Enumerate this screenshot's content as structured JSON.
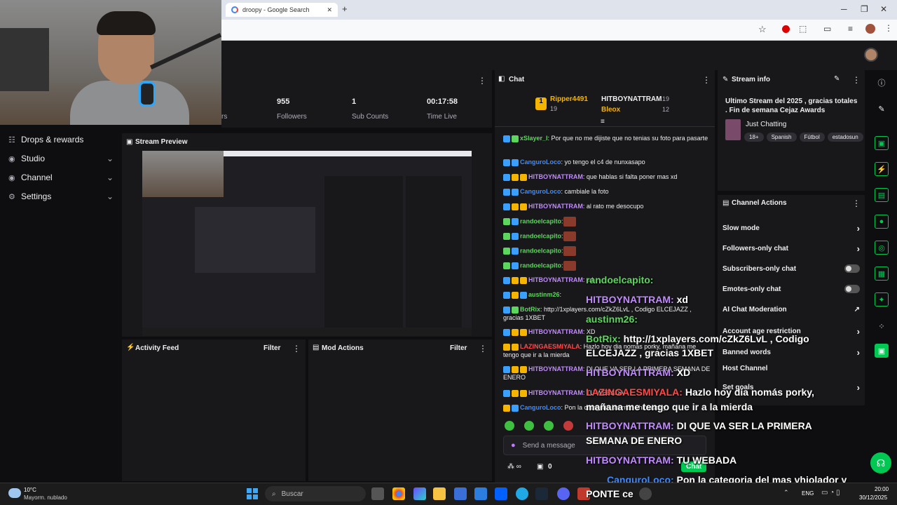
{
  "browser": {
    "tab_title": "droopy - Google Search",
    "new_tab": "+",
    "close_tab": "✕",
    "minimize": "─",
    "restore": "❐",
    "close": "✕"
  },
  "nav": {
    "items": [
      {
        "label": "Drops & rewards",
        "icon": "gift-icon"
      },
      {
        "label": "Studio",
        "icon": "studio-icon"
      },
      {
        "label": "Channel",
        "icon": "channel-icon"
      },
      {
        "label": "Settings",
        "icon": "gear-icon"
      }
    ]
  },
  "stats": {
    "viewers_label": "rs",
    "followers_value": "955",
    "followers_label": "Followers",
    "subs_value": "1",
    "subs_label": "Sub Counts",
    "time_value": "00:17:58",
    "time_label": "Time Live"
  },
  "preview": {
    "title": "Stream Preview"
  },
  "activity": {
    "title": "Activity Feed",
    "filter": "Filter"
  },
  "modactions": {
    "title": "Mod Actions",
    "filter": "Filter"
  },
  "chat": {
    "title": "Chat",
    "leaders": [
      {
        "rank": "1",
        "name": "Ripper4491",
        "count": "19"
      },
      {
        "name": "HITBOYNATTRAM",
        "count": "19"
      },
      {
        "name": "Bleox",
        "count": "12"
      }
    ],
    "messages": [
      {
        "user": "xSlayer_l",
        "color": "green",
        "text": ": Por que no me dijiste que no tenias su foto para pasarte"
      },
      {
        "user": "CanguroLoco",
        "color": "blue",
        "text": ": yo tengo el c4 de nunxasapo"
      },
      {
        "user": "HITBOYNATTRAM",
        "color": "purple",
        "text": ": que hablas si falta poner mas xd"
      },
      {
        "user": "CanguroLoco",
        "color": "blue",
        "text": ": cambiale la foto"
      },
      {
        "user": "HITBOYNATTRAM",
        "color": "purple",
        "text": ": al rato me desocupo"
      },
      {
        "user": "randoelcapito",
        "color": "green",
        "text": ":"
      },
      {
        "user": "randoelcapito",
        "color": "green",
        "text": ":"
      },
      {
        "user": "randoelcapito",
        "color": "green",
        "text": ":"
      },
      {
        "user": "randoelcapito",
        "color": "green",
        "text": ":"
      },
      {
        "user": "HITBOYNATTRAM",
        "color": "purple",
        "text": ": xd"
      },
      {
        "user": "austinm26",
        "color": "green",
        "text": ":"
      },
      {
        "user": "BotRix",
        "color": "green",
        "text": ": http://1xplayers.com/cZkZ6LvL , Codigo ELCEJAZZ , gracias 1XBET"
      },
      {
        "user": "HITBOYNATTRAM",
        "color": "purple",
        "text": ": XD"
      },
      {
        "user": "LAZINGAESMIYALA",
        "color": "red",
        "text": ": Hazlo hoy dia nomás porky, mañana me tengo que ir a la mierda"
      },
      {
        "user": "HITBOYNATTRAM",
        "color": "purple",
        "text": ": DI QUE VA SER LA PRIMERA SEMANA DE ENERO"
      },
      {
        "user": "HITBOYNATTRAM",
        "color": "purple",
        "text": ": TU WEBADA"
      },
      {
        "user": "CanguroLoco",
        "color": "blue",
        "text": ": Pon la categoria del mas vhiolador y"
      }
    ],
    "input_placeholder": "Send a message",
    "points": "0",
    "chat_button": "Chat"
  },
  "overlay": {
    "lines": [
      {
        "user": "randoelcapito:",
        "text": ""
      },
      {
        "user": "HITBOYNATTRAM:",
        "text": " xd"
      },
      {
        "user": "austinm26:",
        "text": ""
      },
      {
        "user": "BotRix:",
        "text": " http://1xplayers.com/cZkZ6LvL , Codigo"
      },
      {
        "user": "",
        "text": "ELCEJAZZ , gracias 1XBET"
      },
      {
        "user": "HITBOYNATTRAM:",
        "text": " XD"
      },
      {
        "user": "LAZINGAESMIYALA:",
        "text": " Hazlo hoy día nomás porky,"
      },
      {
        "user": "",
        "text": "mañana me tengo que ir a la mierda"
      },
      {
        "user": "HITBOYNATTRAM:",
        "text": " DI QUE VA SER LA PRIMERA"
      },
      {
        "user": "",
        "text": "SEMANA DE ENERO"
      },
      {
        "user": "HITBOYNATTRAM:",
        "text": " TU WEBADA"
      },
      {
        "user": "CanguroLoco:",
        "text": " Pon la categoria del mas vhiolador y"
      }
    ]
  },
  "streaminfo": {
    "title": "Stream info",
    "stream_title": "Ultimo Stream del 2025 , gracias totales . Fin de semana Cejaz Awards",
    "category": "Just Chatting",
    "tags": [
      "18+",
      "Spanish",
      "Fútbol",
      "estadosun"
    ]
  },
  "channel_actions": {
    "title": "Channel Actions",
    "items": [
      {
        "label": "Slow mode",
        "control": "chevron"
      },
      {
        "label": "Followers-only chat",
        "control": "chevron"
      },
      {
        "label": "Subscribers-only chat",
        "control": "toggle"
      },
      {
        "label": "Emotes-only chat",
        "control": "toggle"
      },
      {
        "label": "AI Chat Moderation",
        "control": "external"
      },
      {
        "label": "Account age restriction",
        "control": "chevron"
      },
      {
        "label": "Banned words",
        "control": "chevron"
      },
      {
        "label": "Host Channel",
        "control": "none"
      },
      {
        "label": "Set goals",
        "control": "chevron"
      }
    ]
  },
  "taskbar": {
    "weather_temp": "10°C",
    "weather_desc": "Mayorm. nublado",
    "search_placeholder": "Buscar",
    "lang": "ENG",
    "time": "20:00",
    "date": "30/12/2025",
    "ponte_label": "PONTE",
    "ponte_label2": "ce"
  },
  "colors": {
    "twitch_bg": "#0e0e10",
    "panel_bg": "#18181b",
    "accent_purple": "#9147ff",
    "green": "#00c853"
  }
}
